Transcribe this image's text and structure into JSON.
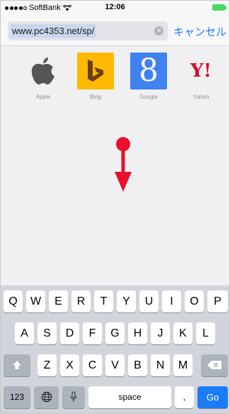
{
  "status_bar": {
    "carrier": "SoftBank",
    "time": "12:06",
    "signal_bars_filled": 4,
    "signal_bars_total": 5
  },
  "address_bar": {
    "url": "www.pc4353.net/sp/",
    "cancel_label": "キャンセル"
  },
  "favorites": [
    {
      "label": "Apple",
      "icon": "apple-logo-icon"
    },
    {
      "label": "Bing",
      "icon": "bing-logo-icon"
    },
    {
      "label": "Google",
      "icon": "google-logo-icon",
      "glyph": "8"
    },
    {
      "label": "Yahoo",
      "icon": "yahoo-logo-icon",
      "glyph": "Y!"
    }
  ],
  "annotation": {
    "icon": "red-arrow-down-icon",
    "color": "#e8102a"
  },
  "keyboard": {
    "row1": [
      "Q",
      "W",
      "E",
      "R",
      "T",
      "Y",
      "U",
      "I",
      "O",
      "P"
    ],
    "row2": [
      "A",
      "S",
      "D",
      "F",
      "G",
      "H",
      "J",
      "K",
      "L"
    ],
    "row3": [
      "Z",
      "X",
      "C",
      "V",
      "B",
      "N",
      "M"
    ],
    "numbers_label": "123",
    "space_label": "space",
    "period_label": ".",
    "go_label": "Go"
  },
  "colors": {
    "accent": "#1b7cf5",
    "bing": "#ffb900",
    "google": "#3f82f0",
    "yahoo": "#d90b2e",
    "battery": "#4cd964"
  }
}
